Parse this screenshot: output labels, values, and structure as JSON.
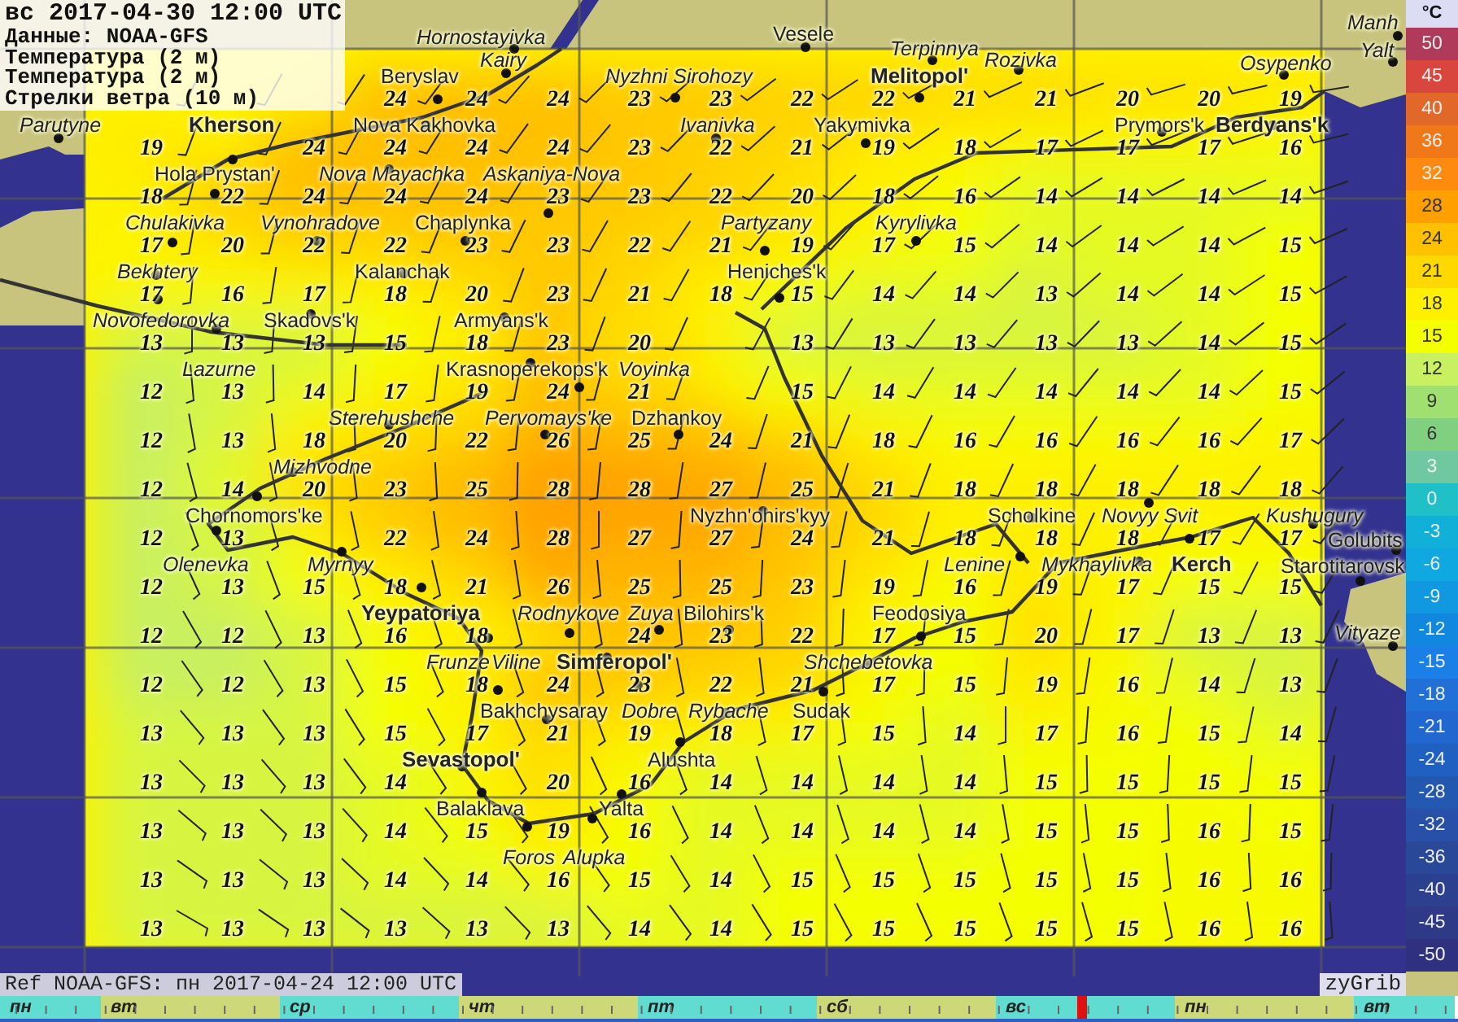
{
  "header": {
    "lines": [
      "вс 2017-04-30 12:00 UTC",
      "Данные: NOAA-GFS",
      "Температура (2 м)",
      "Температура (2 м)",
      "Стрелки ветра (10 м)"
    ]
  },
  "grid": {
    "rows": [
      [
        null,
        null,
        null,
        "24",
        "24",
        "24",
        "23",
        "23",
        "22",
        "22",
        "21",
        "21",
        "20",
        "20",
        "19"
      ],
      [
        "19",
        null,
        "24",
        "24",
        "24",
        "24",
        "23",
        "22",
        "21",
        "19",
        "18",
        "17",
        "17",
        "17",
        "16"
      ],
      [
        "18",
        "22",
        "24",
        "24",
        "24",
        "23",
        "23",
        "22",
        "20",
        "18",
        "16",
        "14",
        "14",
        "14",
        "14"
      ],
      [
        "17",
        "20",
        "22",
        "22",
        "23",
        "23",
        "22",
        "21",
        "19",
        "17",
        "15",
        "14",
        "14",
        "14",
        "15"
      ],
      [
        "17",
        "16",
        "17",
        "18",
        "20",
        "23",
        "21",
        "18",
        "15",
        "14",
        "14",
        "13",
        "14",
        "14",
        "15"
      ],
      [
        "13",
        "13",
        "13",
        "15",
        "18",
        "23",
        "20",
        null,
        "13",
        "13",
        "13",
        "13",
        "13",
        "14",
        "15"
      ],
      [
        "12",
        "13",
        "14",
        "17",
        "19",
        "24",
        "21",
        null,
        "15",
        "14",
        "14",
        "14",
        "14",
        "14",
        "15"
      ],
      [
        "12",
        "13",
        "18",
        "20",
        "22",
        "26",
        "25",
        "24",
        "21",
        "18",
        "16",
        "16",
        "16",
        "16",
        "17"
      ],
      [
        "12",
        "14",
        "20",
        "23",
        "25",
        "28",
        "28",
        "27",
        "25",
        "21",
        "18",
        "18",
        "18",
        "18",
        "18"
      ],
      [
        "12",
        "13",
        null,
        "22",
        "24",
        "28",
        "27",
        "27",
        "24",
        "21",
        "18",
        "18",
        "18",
        "17",
        "17"
      ],
      [
        "12",
        "13",
        "15",
        "18",
        "21",
        "26",
        "25",
        "25",
        "23",
        "19",
        "16",
        "19",
        "17",
        "15",
        "15"
      ],
      [
        "12",
        "12",
        "13",
        "16",
        "18",
        null,
        "24",
        "23",
        "22",
        "17",
        "15",
        "20",
        "17",
        "13",
        "13"
      ],
      [
        "12",
        "12",
        "13",
        "15",
        "18",
        "24",
        "23",
        "22",
        "21",
        "17",
        "15",
        "19",
        "16",
        "14",
        "13"
      ],
      [
        "13",
        "13",
        "13",
        "15",
        "17",
        "21",
        "19",
        "18",
        "17",
        "15",
        "14",
        "17",
        "16",
        "15",
        "14"
      ],
      [
        "13",
        "13",
        "13",
        "14",
        null,
        "20",
        "16",
        "14",
        "14",
        "14",
        "14",
        "15",
        "15",
        "15",
        "15"
      ],
      [
        "13",
        "13",
        "13",
        "14",
        "15",
        "19",
        "16",
        "14",
        "14",
        "14",
        "14",
        "15",
        "15",
        "16",
        "15"
      ],
      [
        "13",
        "13",
        "13",
        "14",
        "14",
        "16",
        "15",
        "14",
        "15",
        "15",
        "15",
        "15",
        "15",
        "16",
        "16"
      ],
      [
        "13",
        "13",
        "13",
        "13",
        "13",
        "13",
        "14",
        "14",
        "15",
        "15",
        "15",
        "15",
        "15",
        "16",
        "16"
      ]
    ]
  },
  "cities": [
    {
      "name": "Manh",
      "kind": "minor"
    },
    {
      "name": "Vesele",
      "kind": "town"
    },
    {
      "name": "Hornostayivka",
      "kind": "minor"
    },
    {
      "name": "Terpinnya",
      "kind": "minor"
    },
    {
      "name": "Yalt",
      "kind": "minor"
    },
    {
      "name": "Kairy",
      "kind": "minor"
    },
    {
      "name": "Rozivka",
      "kind": "minor"
    },
    {
      "name": "Osypenko",
      "kind": "minor"
    },
    {
      "name": "Beryslav",
      "kind": "town"
    },
    {
      "name": "Nyzhni Sirohozy",
      "kind": "minor"
    },
    {
      "name": "Melitopol'",
      "kind": "major"
    },
    {
      "name": "Parutyne",
      "kind": "minor"
    },
    {
      "name": "Kherson",
      "kind": "major"
    },
    {
      "name": "Nova Kakhovka",
      "kind": "town"
    },
    {
      "name": "Ivanivka",
      "kind": "minor"
    },
    {
      "name": "Yakymivka",
      "kind": "town"
    },
    {
      "name": "Prymors'k",
      "kind": "town"
    },
    {
      "name": "Berdyans'k",
      "kind": "major"
    },
    {
      "name": "Hola Prystan'",
      "kind": "town"
    },
    {
      "name": "Nova Mayachka",
      "kind": "minor"
    },
    {
      "name": "Askaniya-Nova",
      "kind": "minor"
    },
    {
      "name": "Chulakivka",
      "kind": "minor"
    },
    {
      "name": "Vynohradove",
      "kind": "minor"
    },
    {
      "name": "Chaplynka",
      "kind": "town"
    },
    {
      "name": "Partyzany",
      "kind": "minor"
    },
    {
      "name": "Kyrylivka",
      "kind": "minor"
    },
    {
      "name": "Bekhtery",
      "kind": "minor"
    },
    {
      "name": "Kalanchak",
      "kind": "town"
    },
    {
      "name": "Heniches'k",
      "kind": "town"
    },
    {
      "name": "Novofedorovka",
      "kind": "minor"
    },
    {
      "name": "Skadovs'k",
      "kind": "town"
    },
    {
      "name": "Armyans'k",
      "kind": "town"
    },
    {
      "name": "Lazurne",
      "kind": "minor"
    },
    {
      "name": "Krasnoperekops'k",
      "kind": "town"
    },
    {
      "name": "Voyinka",
      "kind": "minor"
    },
    {
      "name": "Sterehushche",
      "kind": "minor"
    },
    {
      "name": "Pervomays'ke",
      "kind": "minor"
    },
    {
      "name": "Dzhankoy",
      "kind": "town"
    },
    {
      "name": "Mizhvodne",
      "kind": "minor"
    },
    {
      "name": "Chornomors'ke",
      "kind": "town"
    },
    {
      "name": "Nyzhn'ohirs'kyy",
      "kind": "town"
    },
    {
      "name": "Scholkine",
      "kind": "town"
    },
    {
      "name": "Novyy Svit",
      "kind": "minor"
    },
    {
      "name": "Kushugury",
      "kind": "minor"
    },
    {
      "name": "Golubits",
      "kind": "town"
    },
    {
      "name": "Olenevka",
      "kind": "minor"
    },
    {
      "name": "Myrnyy",
      "kind": "minor"
    },
    {
      "name": "Lenine",
      "kind": "minor"
    },
    {
      "name": "Mykhaylivka",
      "kind": "minor"
    },
    {
      "name": "Kerch",
      "kind": "major"
    },
    {
      "name": "Starotitarovsk",
      "kind": "town"
    },
    {
      "name": "Yeypatoriya",
      "kind": "major"
    },
    {
      "name": "Rodnykove",
      "kind": "minor"
    },
    {
      "name": "Zuya",
      "kind": "minor"
    },
    {
      "name": "Bilohirs'k",
      "kind": "town"
    },
    {
      "name": "Feodosiya",
      "kind": "town"
    },
    {
      "name": "Vityaze",
      "kind": "minor"
    },
    {
      "name": "Frunze",
      "kind": "minor"
    },
    {
      "name": "Viline",
      "kind": "minor"
    },
    {
      "name": "Simferopol'",
      "kind": "major"
    },
    {
      "name": "Shchebetovka",
      "kind": "minor"
    },
    {
      "name": "Bakhchysaray",
      "kind": "town"
    },
    {
      "name": "Dobre",
      "kind": "minor"
    },
    {
      "name": "Rybache",
      "kind": "minor"
    },
    {
      "name": "Sudak",
      "kind": "town"
    },
    {
      "name": "Sevastopol'",
      "kind": "major"
    },
    {
      "name": "Alushta",
      "kind": "town"
    },
    {
      "name": "Balaklava",
      "kind": "town"
    },
    {
      "name": "Yalta",
      "kind": "town"
    },
    {
      "name": "Foros",
      "kind": "minor"
    },
    {
      "name": "Alupka",
      "kind": "minor"
    }
  ],
  "legend": {
    "unit": "°C",
    "items": [
      {
        "label": "50",
        "color": "#b03a5a"
      },
      {
        "label": "45",
        "color": "#d8463e"
      },
      {
        "label": "40",
        "color": "#e2682a"
      },
      {
        "label": "36",
        "color": "#f07818"
      },
      {
        "label": "32",
        "color": "#ff8a10"
      },
      {
        "label": "28",
        "color": "#ffa000"
      },
      {
        "label": "24",
        "color": "#ffc000"
      },
      {
        "label": "21",
        "color": "#ffd800"
      },
      {
        "label": "18",
        "color": "#fff000"
      },
      {
        "label": "15",
        "color": "#f4ff00"
      },
      {
        "label": "12",
        "color": "#c8f060"
      },
      {
        "label": "9",
        "color": "#a0e070"
      },
      {
        "label": "6",
        "color": "#80d080"
      },
      {
        "label": "3",
        "color": "#70c8a0"
      },
      {
        "label": "0",
        "color": "#20c0c8"
      },
      {
        "label": "-3",
        "color": "#10b0d8"
      },
      {
        "label": "-6",
        "color": "#10a8e0"
      },
      {
        "label": "-9",
        "color": "#1098e0"
      },
      {
        "label": "-12",
        "color": "#1088e0"
      },
      {
        "label": "-15",
        "color": "#1a80e8"
      },
      {
        "label": "-18",
        "color": "#2070d8"
      },
      {
        "label": "-21",
        "color": "#2068d0"
      },
      {
        "label": "-24",
        "color": "#2060c0"
      },
      {
        "label": "-28",
        "color": "#2258b0"
      },
      {
        "label": "-32",
        "color": "#2850a8"
      },
      {
        "label": "-36",
        "color": "#2a4898"
      },
      {
        "label": "-40",
        "color": "#2c4090"
      },
      {
        "label": "-45",
        "color": "#2e3a88"
      },
      {
        "label": "-50",
        "color": "#303080"
      }
    ]
  },
  "ref_label": "Ref NOAA-GFS: пн 2017-04-24 12:00 UTC",
  "brand": "zyGrib",
  "timeline": {
    "level": 0.742,
    "days": [
      {
        "label": "пн"
      },
      {
        "label": "вт"
      },
      {
        "label": "ср"
      },
      {
        "label": "чт"
      },
      {
        "label": "пт"
      },
      {
        "label": "сб"
      },
      {
        "label": "вс"
      },
      {
        "label": "пн"
      },
      {
        "label": "вт"
      }
    ]
  }
}
